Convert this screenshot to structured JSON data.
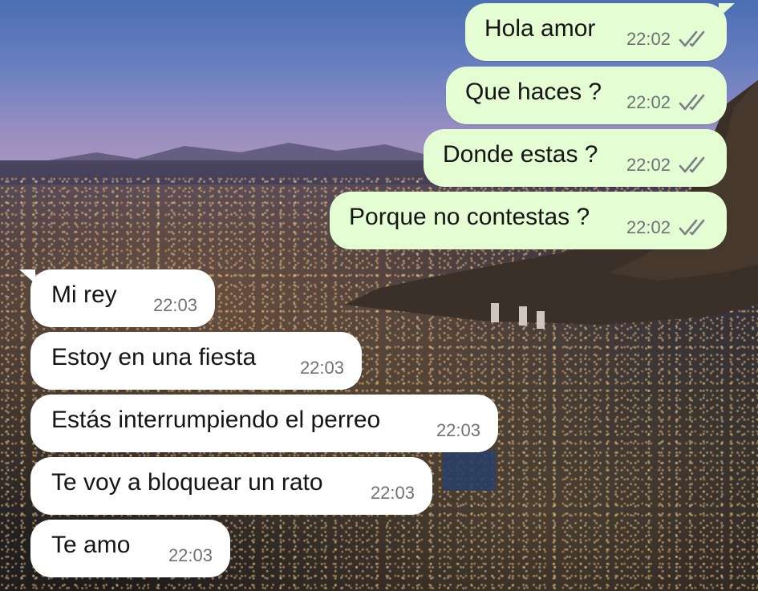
{
  "messages": {
    "outgoing": [
      {
        "text": "Hola amor",
        "time": "22:02",
        "status_icon": "double-check-icon"
      },
      {
        "text": "Que haces ?",
        "time": "22:02",
        "status_icon": "double-check-icon"
      },
      {
        "text": "Donde estas ?",
        "time": "22:02",
        "status_icon": "double-check-icon"
      },
      {
        "text": "Porque no contestas ?",
        "time": "22:02",
        "status_icon": "double-check-icon"
      }
    ],
    "incoming": [
      {
        "text": "Mi rey",
        "time": "22:03"
      },
      {
        "text": "Estoy en una fiesta",
        "time": "22:03"
      },
      {
        "text": "Estás interrumpiendo el perreo",
        "time": "22:03"
      },
      {
        "text": "Te voy a bloquear un rato",
        "time": "22:03"
      },
      {
        "text": "Te amo",
        "time": "22:03"
      }
    ]
  },
  "colors": {
    "outgoing_bubble": "#e4fdd3",
    "incoming_bubble": "#ffffff",
    "timestamp": "#6f7275",
    "ticks": "#7c8086"
  },
  "wallpaper": {
    "scene": "city at dusk"
  }
}
